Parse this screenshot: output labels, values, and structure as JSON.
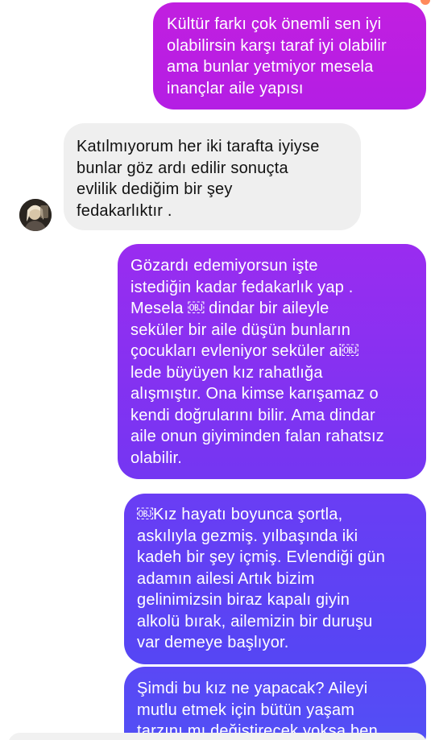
{
  "messages": [
    {
      "id": "m1",
      "direction": "sent",
      "text": "Kültür farkı çok önemli sen iyi\nolabilirsin karşı taraf iyi olabilir\nama bunlar yetmiyor mesela\ninançlar aile yapısı"
    },
    {
      "id": "m2",
      "direction": "received",
      "text": "Katılmıyorum her iki tarafta iyiyse\nbunlar göz ardı edilir sonuçta\nevlilik dediğim bir şey\nfedakarlıktır ."
    },
    {
      "id": "m3",
      "direction": "sent",
      "text": "Gözardı edemiyorsun işte\nistediğin kadar fedakarlık yap .\nMesela ￼ dindar bir aileyle\nseküler bir aile düşün bunların\nçocukları evleniyor seküler ai￼\nlede büyüyen kız rahatlığa\nalışmıştır. Ona kimse karışamaz o\nkendi doğrularını bilir. Ama dindar\naile onun giyiminden falan rahatsız\nolabilir."
    },
    {
      "id": "m4",
      "direction": "sent",
      "text": "￼Kız hayatı boyunca şortla,\naskılıyla gezmiş. yılbaşında iki\nkadeh bir şey içmiş. Evlendiği gün\nadamın ailesi Artık bizim\ngelinimizsin biraz kapalı giyin\nalkolü bırak, ailemizin bir duruşu\nvar demeye başlıyor."
    },
    {
      "id": "m5",
      "direction": "sent",
      "text": "Şimdi bu kız ne yapacak? Aileyi\nmutlu etmek için bütün yaşam\ntarzını mı değiştirecek yoksa ben"
    }
  ],
  "colors": {
    "sent_gradient_start": "#c11fe0",
    "sent_gradient_end": "#5050f5",
    "received_bubble": "#efefef",
    "received_text": "#111111",
    "sent_text": "#ffffff"
  },
  "icons": {
    "avatar": "contact-avatar-photo"
  }
}
